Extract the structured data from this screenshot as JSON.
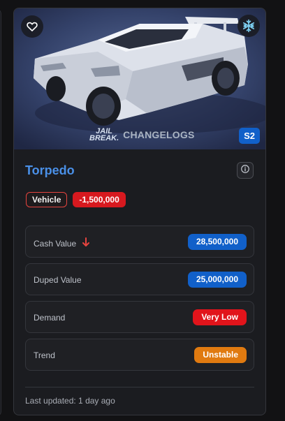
{
  "item": {
    "name": "Torpedo",
    "type_tag": "Vehicle",
    "value_change": "-1,500,000",
    "season_badge": "S2",
    "watermark_logo_line1": "JAIL",
    "watermark_logo_line2": "BREAK.",
    "watermark_text": "CHANGELOGS"
  },
  "stats": [
    {
      "label": "Cash Value",
      "value": "28,500,000",
      "color": "#1160c9",
      "trend_icon": "arrow-down-icon"
    },
    {
      "label": "Duped Value",
      "value": "25,000,000",
      "color": "#1160c9"
    },
    {
      "label": "Demand",
      "value": "Very Low",
      "color": "#e1141b"
    },
    {
      "label": "Trend",
      "value": "Unstable",
      "color": "#e07a10"
    }
  ],
  "footer": {
    "last_updated": "Last updated: 1 day ago"
  },
  "icons": {
    "favorite": "heart-icon",
    "limited": "snowflake-icon",
    "info": "info-icon"
  },
  "colors": {
    "accent": "#4a90e8",
    "background": "#121214",
    "card": "#1b1c20"
  }
}
